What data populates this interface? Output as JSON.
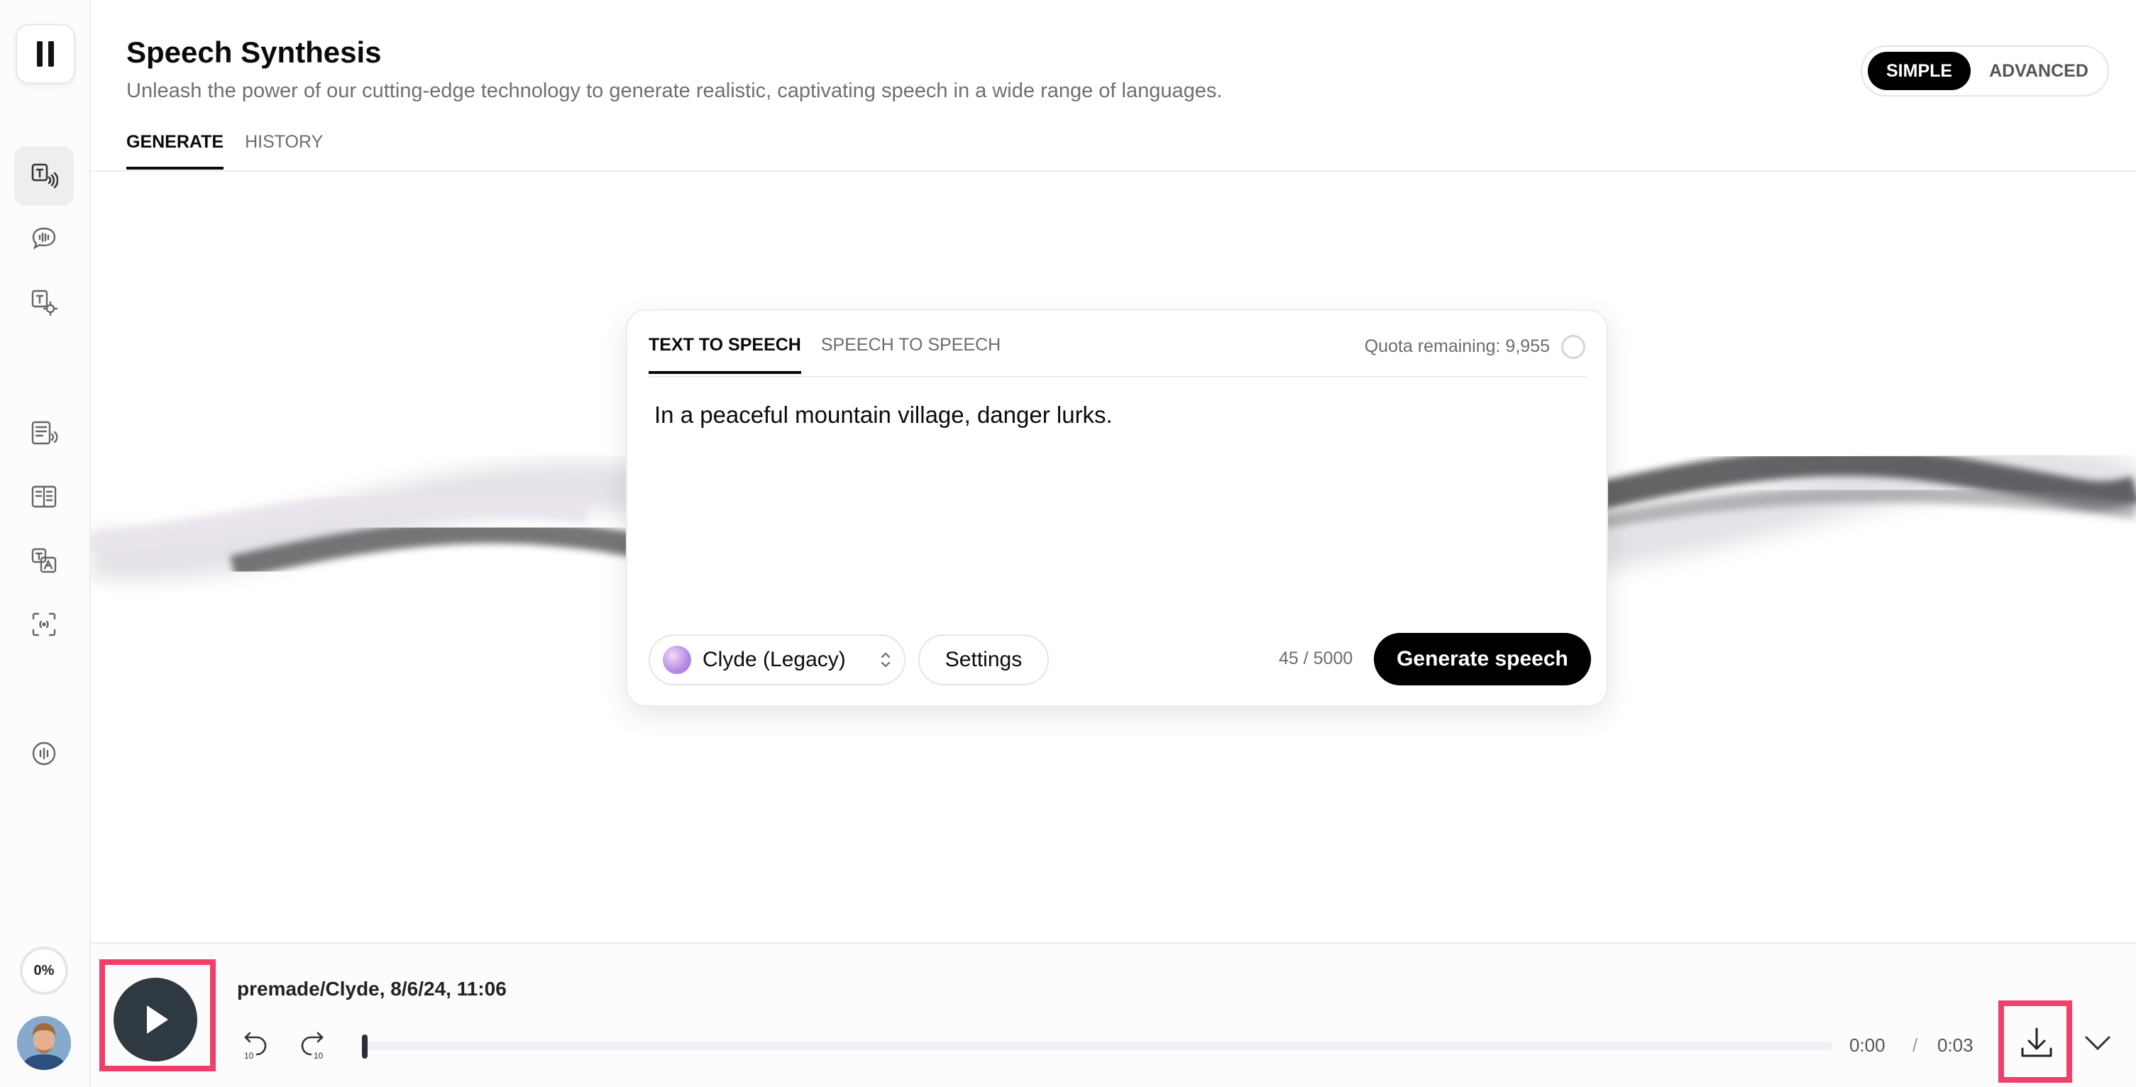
{
  "header": {
    "title": "Speech Synthesis",
    "subtitle": "Unleash the power of our cutting-edge technology to generate realistic, captivating speech in a wide range of languages.",
    "tabs": [
      {
        "label": "GENERATE",
        "active": true
      },
      {
        "label": "HISTORY",
        "active": false
      }
    ],
    "mode_toggle": {
      "options": [
        "SIMPLE",
        "ADVANCED"
      ],
      "selected": "SIMPLE"
    }
  },
  "sidebar": {
    "icons": [
      {
        "name": "text-to-speech-icon",
        "active": true
      },
      {
        "name": "speech-bubble-icon",
        "active": false
      },
      {
        "name": "voice-settings-icon",
        "active": false
      },
      {
        "name": "audio-document-icon",
        "active": false
      },
      {
        "name": "book-icon",
        "active": false
      },
      {
        "name": "translate-icon",
        "active": false
      },
      {
        "name": "voice-isolator-icon",
        "active": false
      },
      {
        "name": "sound-effects-icon",
        "active": false
      }
    ],
    "usage": "0%"
  },
  "card": {
    "tabs": [
      {
        "label": "TEXT TO SPEECH",
        "active": true
      },
      {
        "label": "SPEECH TO SPEECH",
        "active": false
      }
    ],
    "quota": "Quota remaining: 9,955",
    "text": "In a peaceful mountain village, danger lurks.",
    "voice": "Clyde (Legacy)",
    "settings_label": "Settings",
    "char_count": "45 / 5000",
    "generate_label": "Generate speech"
  },
  "player": {
    "track_title": "premade/Clyde, 8/6/24, 11:06",
    "current_time": "0:00",
    "separator": "/",
    "total_time": "0:03",
    "progress": 0
  },
  "colors": {
    "accent": "#000000",
    "highlight": "#f0406a",
    "play_button": "#2f3942"
  }
}
